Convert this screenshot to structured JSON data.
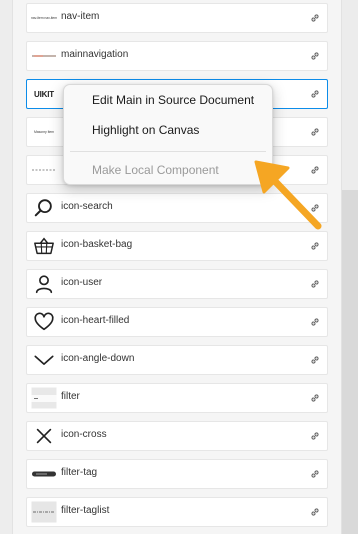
{
  "components": [
    {
      "label": "nav-item",
      "thumb": "tiny-text-icon",
      "thumb_text": "nav-item nav-item",
      "selected": false
    },
    {
      "label": "mainnavigation",
      "thumb": "line-thumb-icon",
      "thumb_text": "",
      "selected": false
    },
    {
      "label": "",
      "thumb": "logo-thumb-icon",
      "thumb_text": "UIKIT",
      "selected": true
    },
    {
      "label": "",
      "thumb": "tiny-text-icon",
      "thumb_text": "Masonry Item",
      "selected": false
    },
    {
      "label": "",
      "thumb": "dashed-thumb-icon",
      "thumb_text": "",
      "selected": false
    },
    {
      "label": "icon-search",
      "thumb": "search-icon",
      "thumb_text": "",
      "selected": false
    },
    {
      "label": "icon-basket-bag",
      "thumb": "basket-icon",
      "thumb_text": "",
      "selected": false
    },
    {
      "label": "icon-user",
      "thumb": "user-icon",
      "thumb_text": "",
      "selected": false
    },
    {
      "label": "icon-heart-filled",
      "thumb": "heart-icon",
      "thumb_text": "",
      "selected": false
    },
    {
      "label": "icon-angle-down",
      "thumb": "angle-down-icon",
      "thumb_text": "",
      "selected": false
    },
    {
      "label": "filter",
      "thumb": "filter-thumb-icon",
      "thumb_text": "",
      "selected": false
    },
    {
      "label": "icon-cross",
      "thumb": "cross-icon",
      "thumb_text": "",
      "selected": false
    },
    {
      "label": "filter-tag",
      "thumb": "tag-thumb-icon",
      "thumb_text": "",
      "selected": false
    },
    {
      "label": "filter-taglist",
      "thumb": "taglist-thumb-icon",
      "thumb_text": "",
      "selected": false
    }
  ],
  "context_menu": {
    "items": [
      {
        "label": "Edit Main in Source Document",
        "enabled": true
      },
      {
        "label": "Highlight on Canvas",
        "enabled": true
      },
      {
        "label": "Make Local Component",
        "enabled": false
      }
    ]
  },
  "colors": {
    "selection": "#0c8ce9",
    "arrow": "#f5a623",
    "logo_accent": "#f08a00"
  }
}
